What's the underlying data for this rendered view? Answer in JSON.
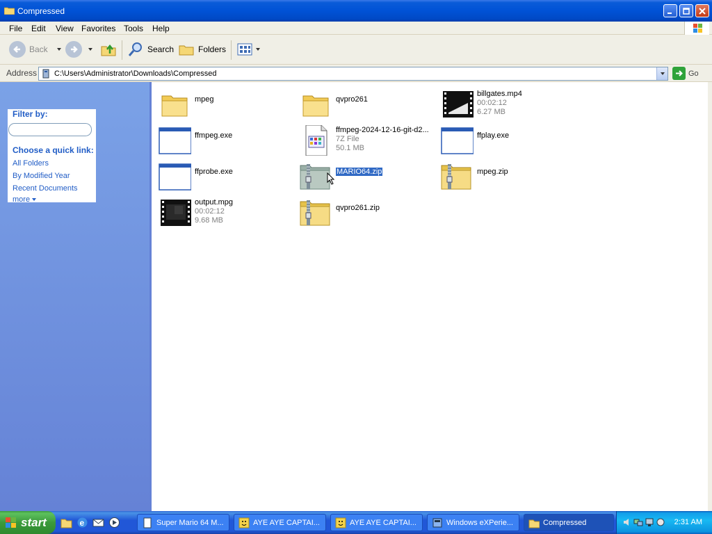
{
  "window": {
    "title": "Compressed"
  },
  "menu": [
    "File",
    "Edit",
    "View",
    "Favorites",
    "Tools",
    "Help"
  ],
  "toolbar": {
    "back": "Back",
    "search": "Search",
    "folders": "Folders"
  },
  "address": {
    "label": "Address",
    "path": "C:\\Users\\Administrator\\Downloads\\Compressed",
    "go": "Go"
  },
  "sidebar": {
    "filter_label": "Filter by:",
    "quick_label": "Choose a quick link:",
    "links": [
      "All Folders",
      "By Modified Year",
      "Recent Documents",
      "more"
    ]
  },
  "files": [
    {
      "name": "mpeg",
      "kind": "folder"
    },
    {
      "name": "qvpro261",
      "kind": "folder"
    },
    {
      "name": "billgates.mp4",
      "kind": "video",
      "line1": "00:02:12",
      "line2": "6.27 MB"
    },
    {
      "name": "ffmpeg.exe",
      "kind": "exe"
    },
    {
      "name": "ffmpeg-2024-12-16-git-d2...",
      "kind": "7z",
      "line1": "7Z File",
      "line2": "50.1 MB"
    },
    {
      "name": "ffplay.exe",
      "kind": "exe"
    },
    {
      "name": "ffprobe.exe",
      "kind": "exe"
    },
    {
      "name": "MARIO64.zip",
      "kind": "zip",
      "selected": true
    },
    {
      "name": "mpeg.zip",
      "kind": "zip"
    },
    {
      "name": "output.mpg",
      "kind": "video2",
      "line1": "00:02:12",
      "line2": "9.68 MB"
    },
    {
      "name": "qvpro261.zip",
      "kind": "zip"
    }
  ],
  "taskbar": {
    "start": "start",
    "tasks": [
      "Super Mario 64 M...",
      "AYE AYE CAPTAI...",
      "AYE AYE CAPTAI...",
      "Windows eXPerie...",
      "Compressed"
    ],
    "clock": "2:31 AM"
  },
  "colors": {
    "accent": "#0052d6",
    "sidebar": "#7ba2e7",
    "selection": "#316ac5",
    "link": "#215dc6"
  }
}
